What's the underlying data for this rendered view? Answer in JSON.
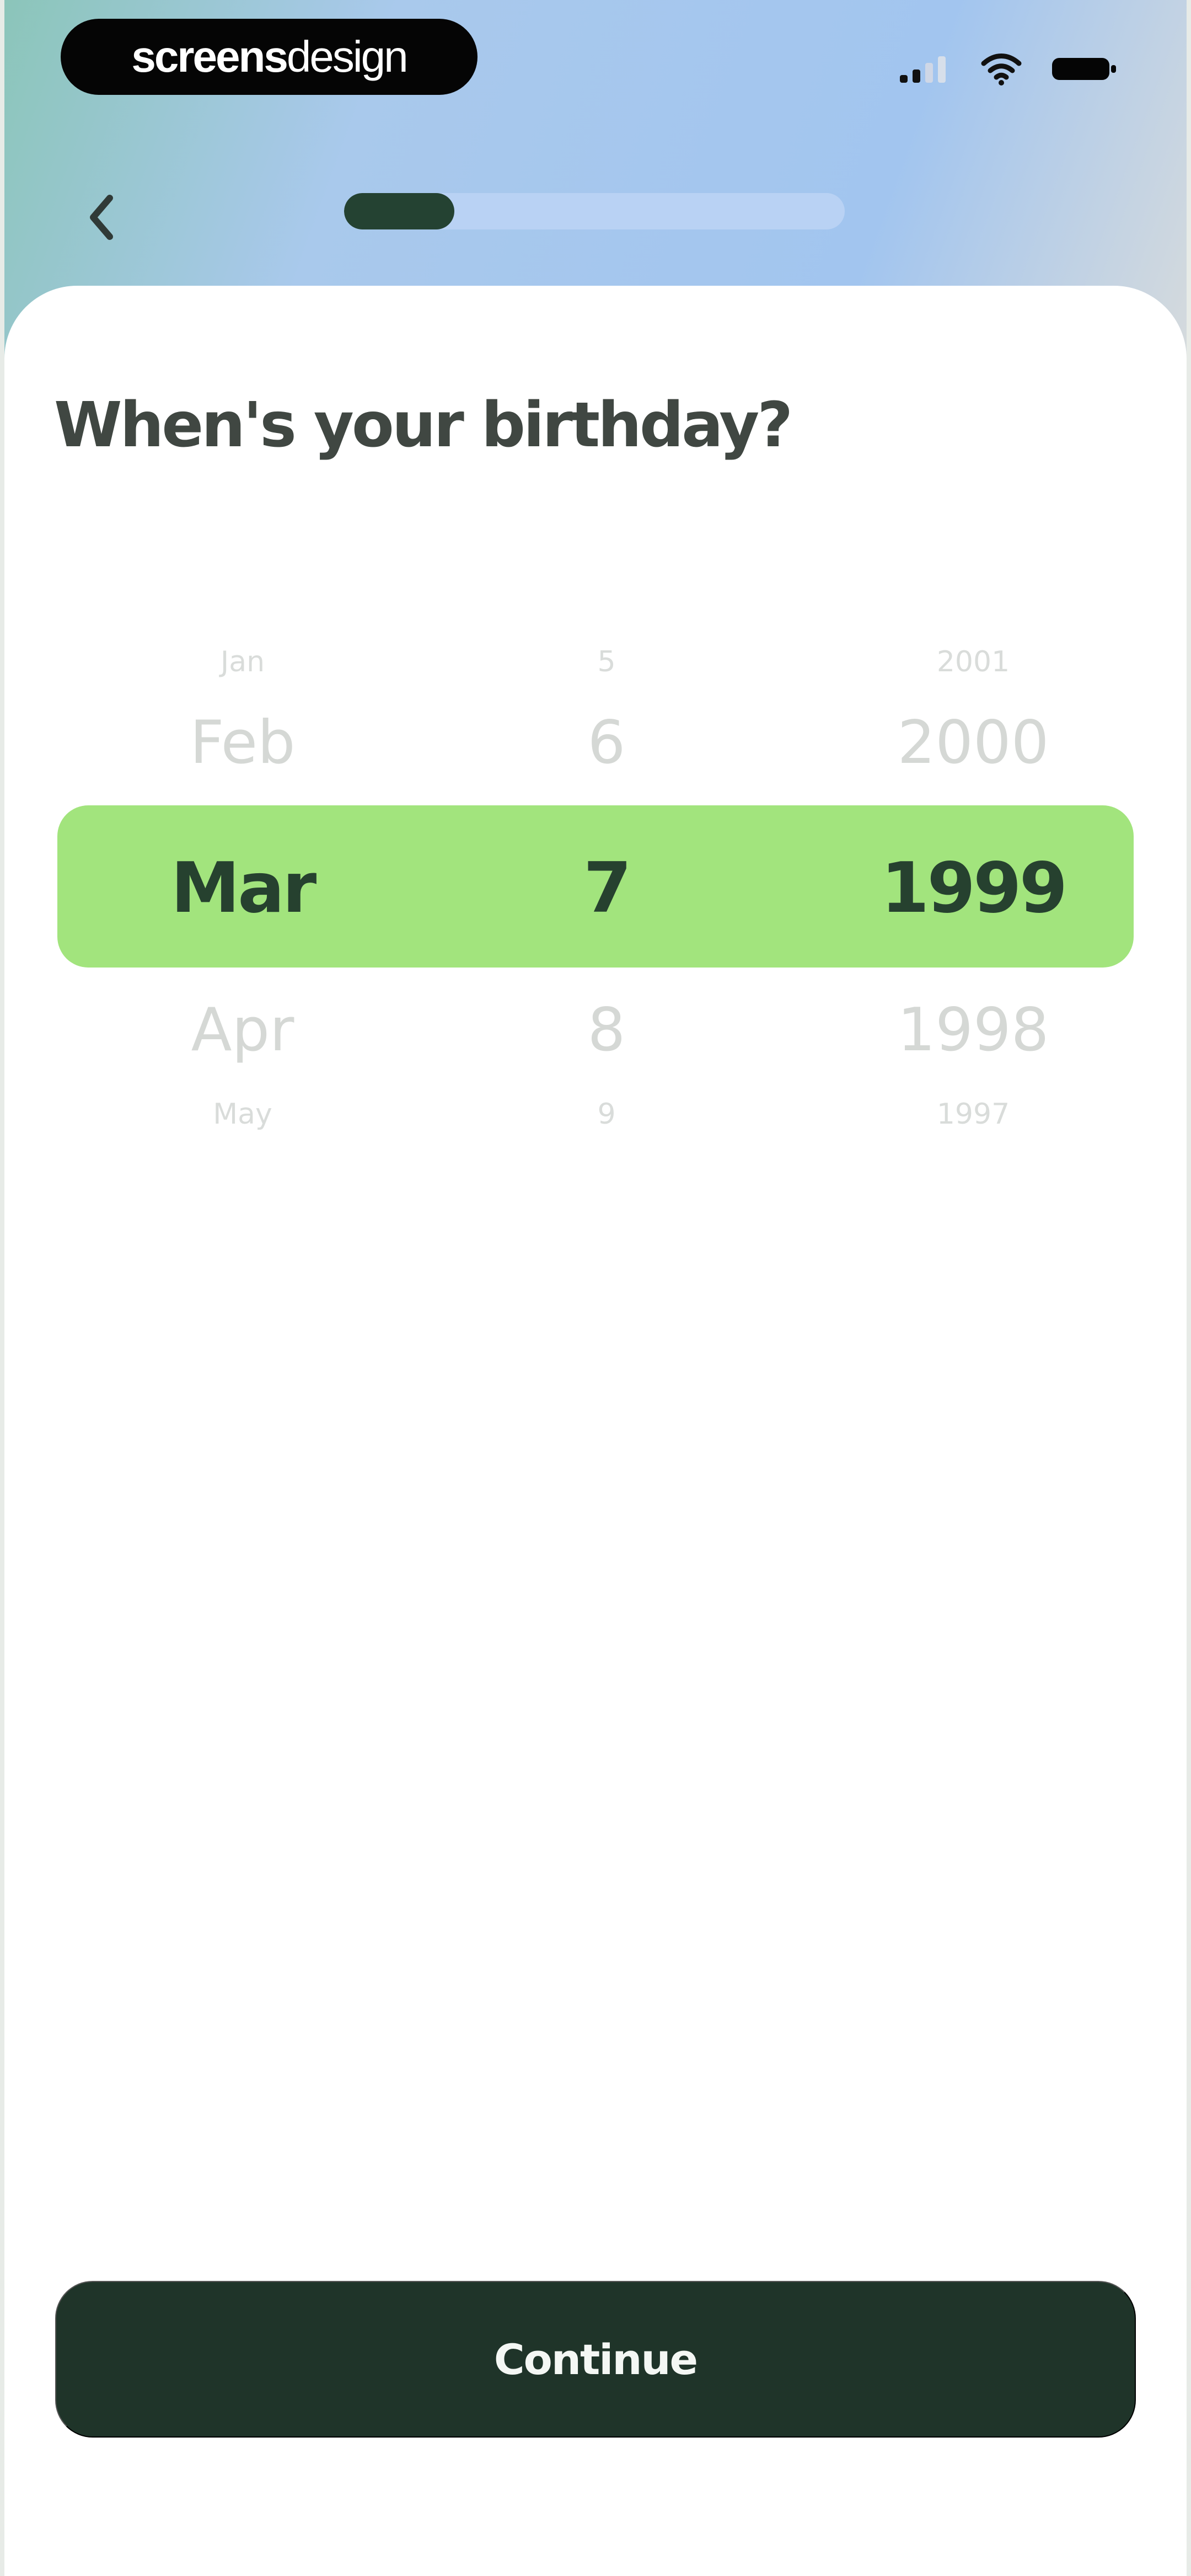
{
  "status_bar": {
    "brand_strong": "screens",
    "brand_light": "design",
    "icons": [
      "signal-icon",
      "wifi-icon",
      "battery-icon"
    ]
  },
  "navigation": {
    "back_icon": "chevron-left-icon",
    "progress": 0.22
  },
  "question": {
    "title": "When's your birthday?"
  },
  "birthday_picker": {
    "month": {
      "faint_above": "Jan",
      "above": "Feb",
      "selected": "Mar",
      "below": "Apr",
      "faint_below": "May"
    },
    "day": {
      "faint_above": "5",
      "above": "6",
      "selected": "7",
      "below": "8",
      "faint_below": "9"
    },
    "year": {
      "faint_above": "2001",
      "above": "2000",
      "selected": "1999",
      "below": "1998",
      "faint_below": "1997"
    }
  },
  "actions": {
    "continue_label": "Continue"
  },
  "colors": {
    "highlight": "#a2e47d",
    "button": "#1f3429",
    "progress_fill": "#244232",
    "progress_track": "#b9d2f4"
  }
}
